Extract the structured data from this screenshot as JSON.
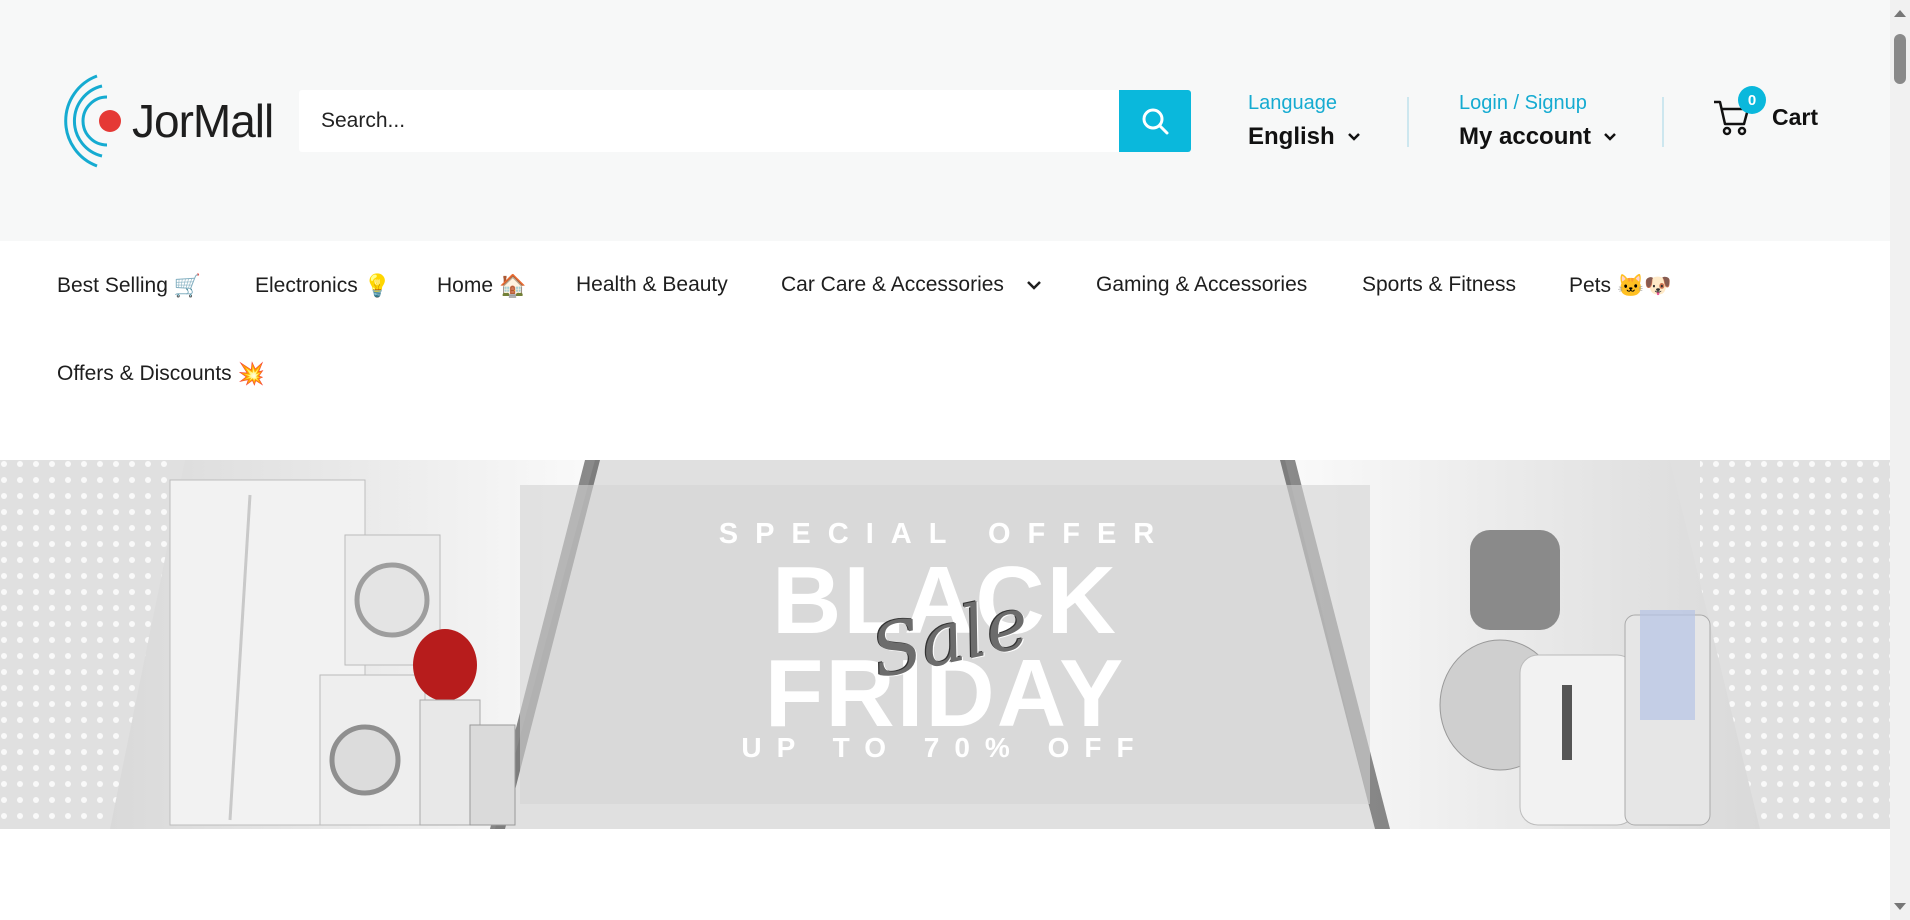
{
  "header": {
    "logo": {
      "text": "JorMall"
    },
    "search": {
      "placeholder": "Search..."
    },
    "language": {
      "label": "Language",
      "value": "English"
    },
    "account": {
      "label": "Login / Signup",
      "value": "My account"
    },
    "cart": {
      "label": "Cart",
      "count": "0"
    }
  },
  "nav": {
    "items": [
      {
        "label": "Best Selling",
        "emoji": "🛒"
      },
      {
        "label": "Electronics",
        "emoji": "💡"
      },
      {
        "label": "Home",
        "emoji": "🏠"
      },
      {
        "label": "Health & Beauty",
        "emoji": ""
      },
      {
        "label": "Car Care & Accessories",
        "emoji": ""
      },
      {
        "label": "Gaming & Accessories",
        "emoji": ""
      },
      {
        "label": "Sports & Fitness",
        "emoji": ""
      },
      {
        "label": "Pets",
        "emoji": "🐱🐶"
      },
      {
        "label": "Offers & Discounts",
        "emoji": "💥"
      }
    ]
  },
  "banner": {
    "line1": "SPECIAL OFFER",
    "line2": "BLACK",
    "line3": "FRIDAY",
    "script": "Sale",
    "line4": "UP TO 70% OFF"
  },
  "colors": {
    "accent": "#0ab8dc",
    "header_bg": "#f7f8f8",
    "logo_red": "#e53935"
  }
}
